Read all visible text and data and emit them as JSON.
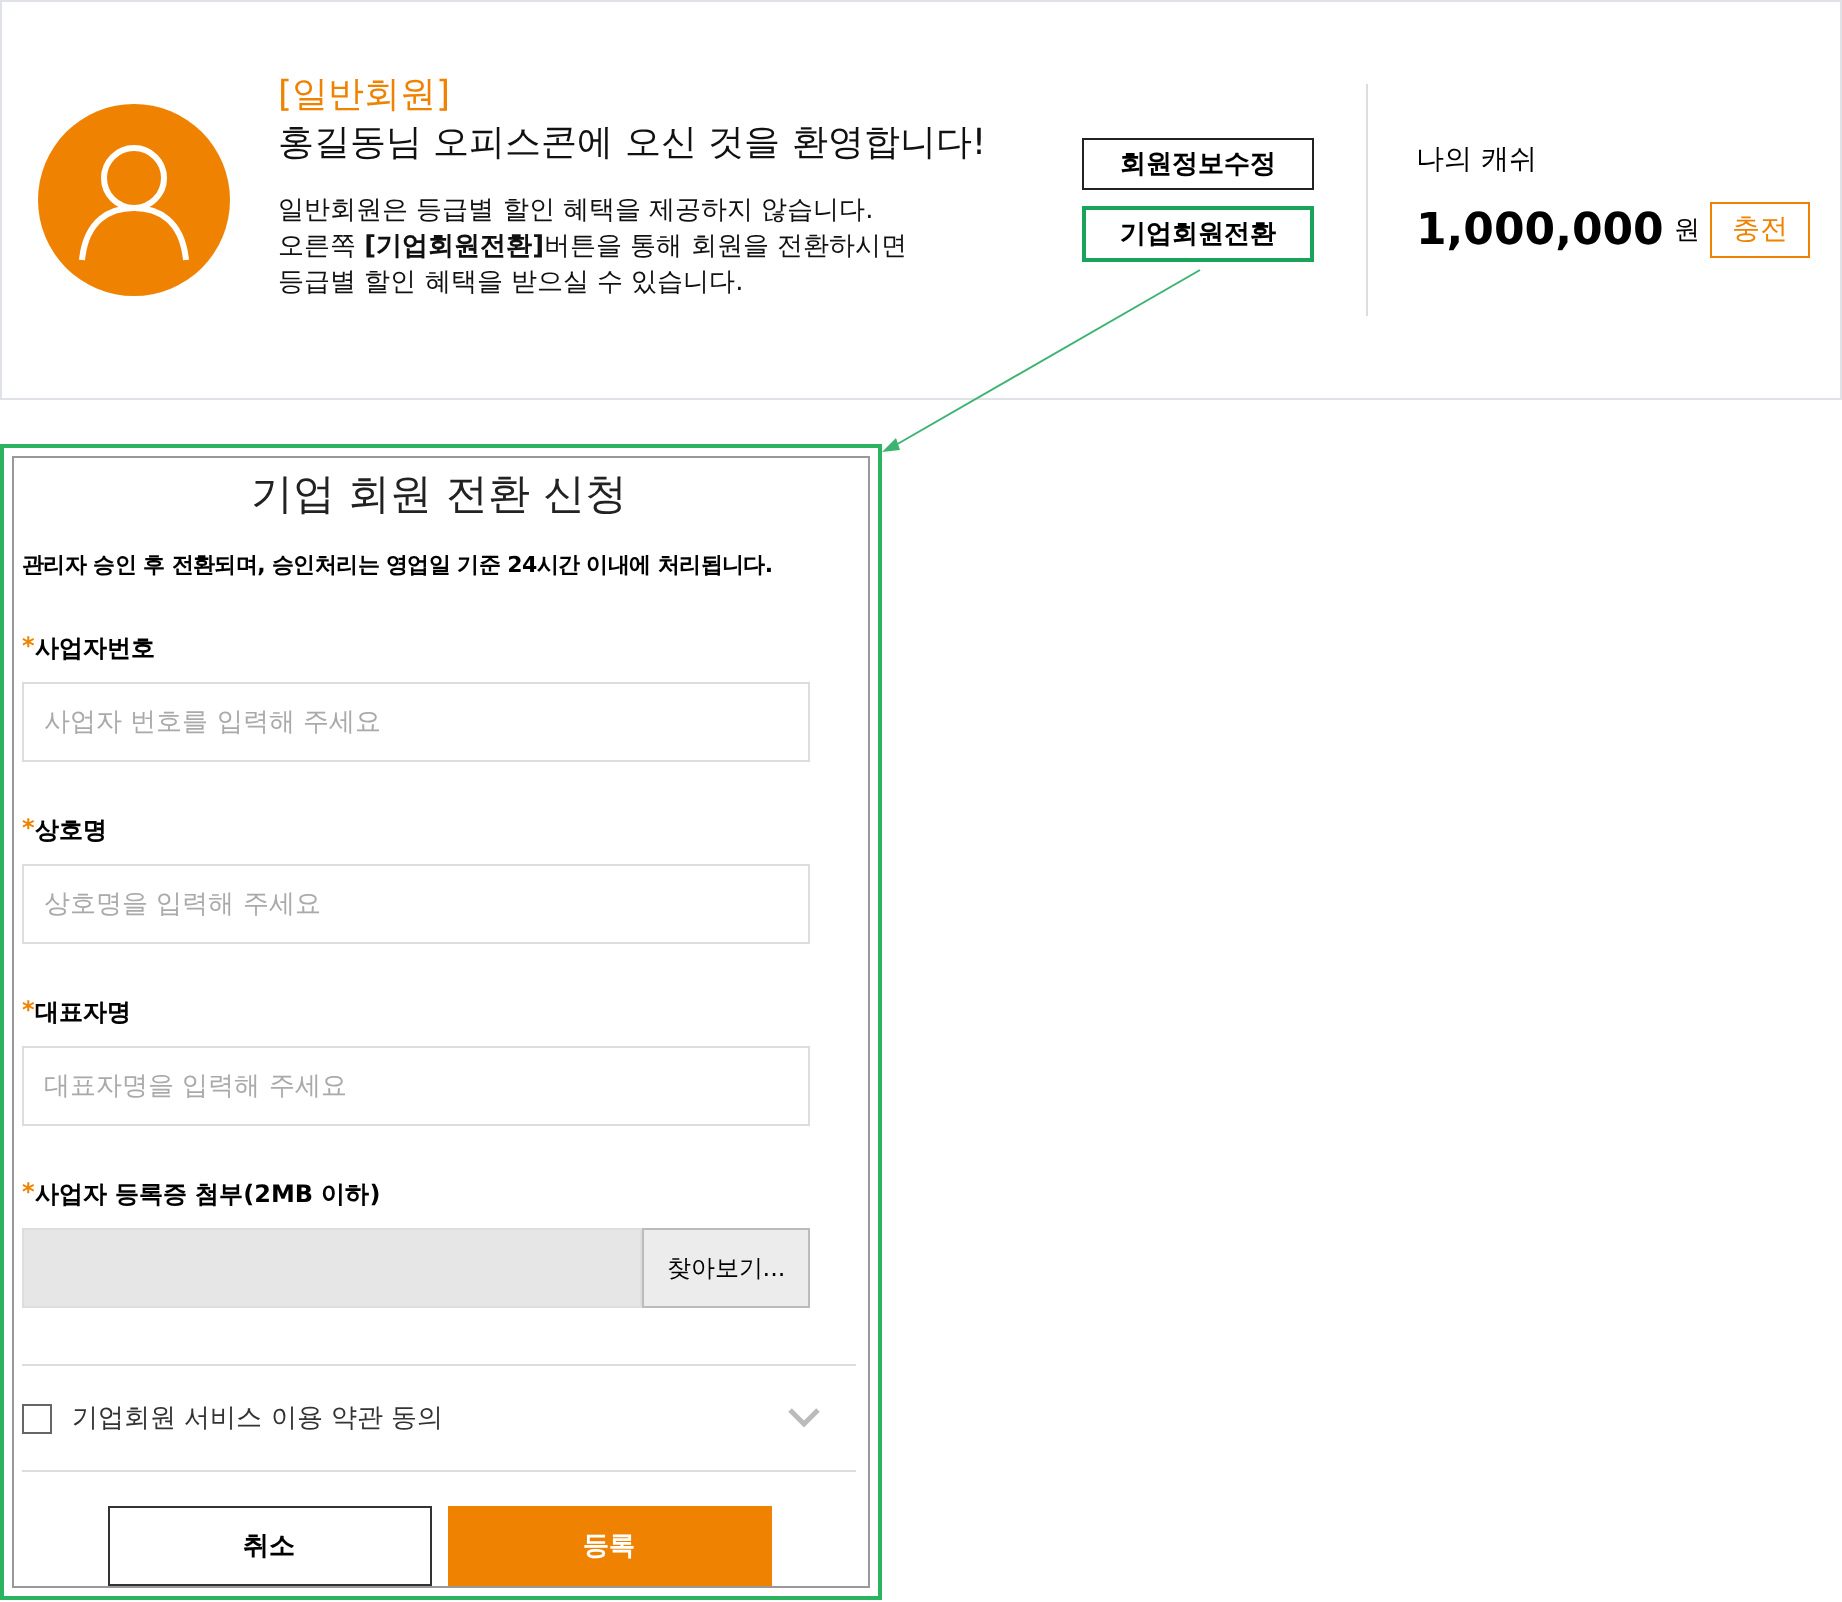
{
  "profile": {
    "grade": "[일반회원]",
    "welcome": "홍길동님 오피스콘에 오신 것을 환영합니다!",
    "notice_lines": [
      "일반회원은 등급별 할인 혜택을 제공하지 않습니다.",
      "오른쪽 **[기업회원전환]**버튼을 통해 회원을 전환하시면",
      "등급별 할인 혜택을 받으실 수 있습니다."
    ],
    "buttons": [
      {
        "label": "회원정보수정",
        "highlighted": false
      },
      {
        "label": "기업회원전환",
        "highlighted": true
      }
    ],
    "cash": {
      "label": "나의 캐쉬",
      "amount": "1,000,000",
      "unit": "원",
      "charge_button": "충전"
    }
  },
  "dialog": {
    "title": "기업 회원 전환 신청",
    "notice": "관리자 승인 후 전환되며, 승인처리는 영업일 기준 24시간 이내에 처리됩니다.",
    "fields": [
      {
        "kind": "text",
        "required_mark": "*",
        "label": "사업자번호",
        "placeholder": "사업자 번호를 입력해 주세요"
      },
      {
        "kind": "text",
        "required_mark": "*",
        "label": "상호명",
        "placeholder": "상호명을 입력해 주세요"
      },
      {
        "kind": "text",
        "required_mark": "*",
        "label": "대표자명",
        "placeholder": "대표자명을 입력해 주세요"
      },
      {
        "kind": "file",
        "required_mark": "*",
        "label": "사업자 등록증 첨부(2MB 이하)",
        "button": "찾아보기..."
      }
    ],
    "agreement": {
      "label": "기업회원 서비스 이용 약관 동의",
      "checked": false,
      "expanded": false
    },
    "actions": [
      {
        "kind": "secondary",
        "label": "취소"
      },
      {
        "kind": "primary",
        "label": "등록"
      }
    ]
  }
}
